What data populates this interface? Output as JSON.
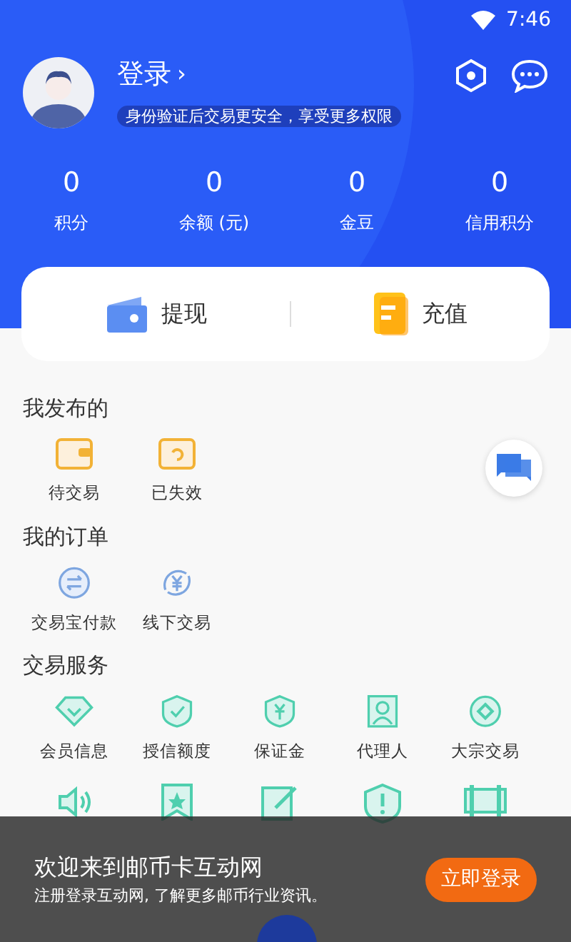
{
  "status_bar": {
    "time": "7:46"
  },
  "profile": {
    "login": "登录",
    "chevron": "›",
    "notice": "身份验证后交易更安全，享受更多权限"
  },
  "stats": [
    {
      "value": "0",
      "label": "积分"
    },
    {
      "value": "0",
      "label": "余额 (元)"
    },
    {
      "value": "0",
      "label": "金豆"
    },
    {
      "value": "0",
      "label": "信用积分"
    }
  ],
  "wallet_actions": [
    {
      "kind": "wallet",
      "label": "提现"
    },
    {
      "kind": "doc",
      "label": "充值"
    }
  ],
  "sections": [
    {
      "title": "我发布的",
      "items": [
        {
          "kind": "wallet-box",
          "label": "待交易"
        },
        {
          "kind": "undo-box",
          "label": "已失效"
        }
      ]
    },
    {
      "title": "我的订单",
      "items": [
        {
          "kind": "swap",
          "label": "交易宝付款"
        },
        {
          "kind": "yen-cycle",
          "label": "线下交易"
        }
      ]
    },
    {
      "title": "交易服务",
      "items": [
        {
          "kind": "diamond",
          "label": "会员信息"
        },
        {
          "kind": "shield-check",
          "label": "授信额度"
        },
        {
          "kind": "shield-yen",
          "label": "保证金"
        },
        {
          "kind": "person",
          "label": "代理人"
        },
        {
          "kind": "circle-diamond",
          "label": "大宗交易"
        },
        {
          "kind": "speaker"
        },
        {
          "kind": "star-bookmark"
        },
        {
          "kind": "edit"
        },
        {
          "kind": "shield-alert"
        },
        {
          "kind": "card"
        }
      ]
    }
  ],
  "banner": {
    "title": "欢迎来到邮币卡互动网",
    "subtitle": "注册登录互动网, 了解更多邮币行业资讯。",
    "button": "立即登录"
  }
}
